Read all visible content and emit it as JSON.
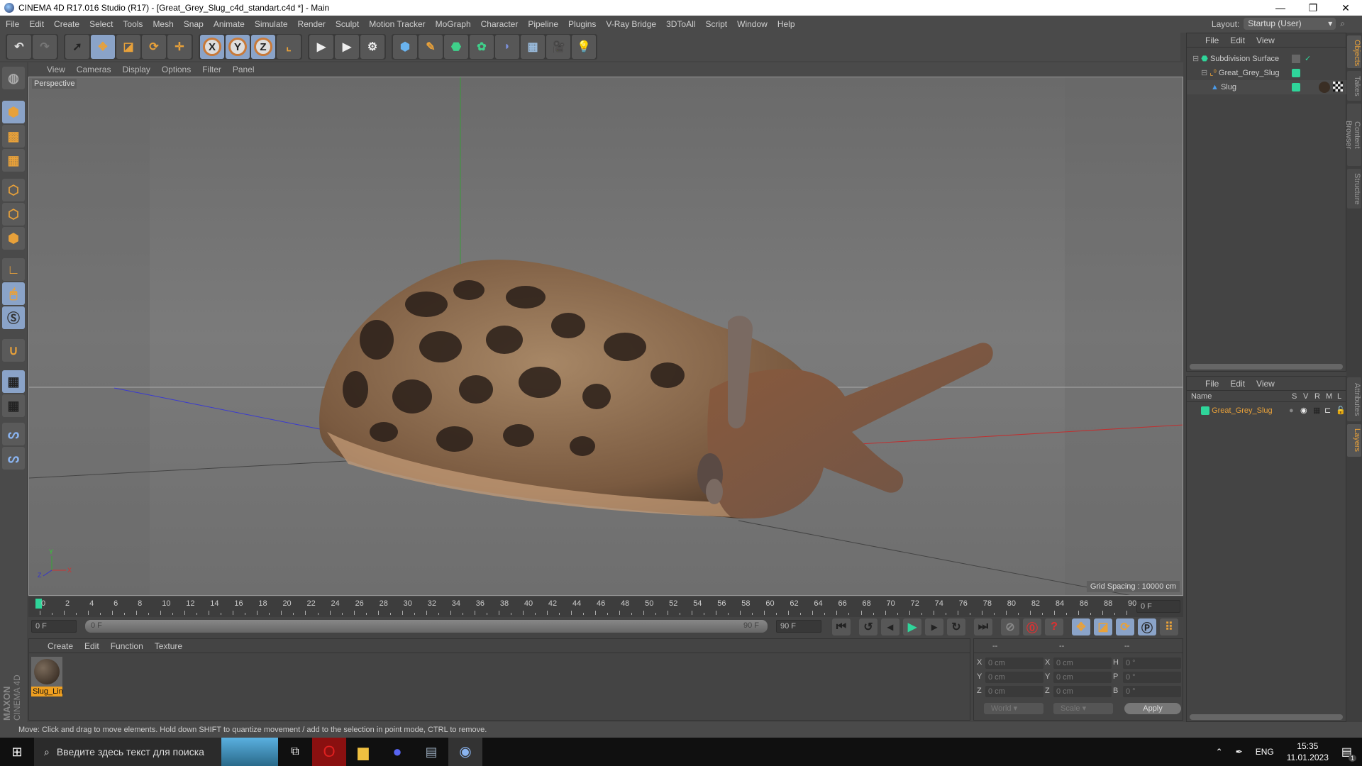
{
  "window": {
    "title": "CINEMA 4D R17.016 Studio (R17) - [Great_Grey_Slug_c4d_standart.c4d *] - Main",
    "minimize": "—",
    "maximize": "❐",
    "close": "✕"
  },
  "menu": [
    "File",
    "Edit",
    "Create",
    "Select",
    "Tools",
    "Mesh",
    "Snap",
    "Animate",
    "Simulate",
    "Render",
    "Sculpt",
    "Motion Tracker",
    "MoGraph",
    "Character",
    "Pipeline",
    "Plugins",
    "V-Ray Bridge",
    "3DToAll",
    "Script",
    "Window",
    "Help"
  ],
  "layout": {
    "label": "Layout:",
    "value": "Startup (User)"
  },
  "toolbar": {
    "axis": [
      "X",
      "Y",
      "Z"
    ]
  },
  "viewport": {
    "menu": [
      "View",
      "Cameras",
      "Display",
      "Options",
      "Filter",
      "Panel"
    ],
    "camera": "Perspective",
    "grid_spacing": "Grid Spacing : 10000 cm",
    "axis_labels": {
      "x": "X",
      "y": "Y",
      "z": "Z"
    }
  },
  "timeline": {
    "start": 0,
    "end": 90,
    "step": 2,
    "current_frame": "0 F",
    "start_field": "0 F",
    "range_start": "0 F",
    "range_end": "90 F",
    "end_field": "90 F"
  },
  "material_manager": {
    "menu": [
      "Create",
      "Edit",
      "Function",
      "Texture"
    ],
    "materials": [
      {
        "name": "Slug_Lin"
      }
    ]
  },
  "coordinates": {
    "headers": [
      "--",
      "--",
      "--"
    ],
    "rows": [
      {
        "l1": "X",
        "v1": "0 cm",
        "l2": "X",
        "v2": "0 cm",
        "l3": "H",
        "v3": "0 °"
      },
      {
        "l1": "Y",
        "v1": "0 cm",
        "l2": "Y",
        "v2": "0 cm",
        "l3": "P",
        "v3": "0 °"
      },
      {
        "l1": "Z",
        "v1": "0 cm",
        "l2": "Z",
        "v2": "0 cm",
        "l3": "B",
        "v3": "0 °"
      }
    ],
    "mode": "World",
    "transform": "Scale",
    "apply": "Apply"
  },
  "object_manager": {
    "menu": [
      "File",
      "Edit",
      "View"
    ],
    "objects": [
      {
        "name": "Subdivision Surface"
      },
      {
        "name": "Great_Grey_Slug"
      },
      {
        "name": "Slug"
      }
    ]
  },
  "layer_manager": {
    "menu": [
      "File",
      "Edit",
      "View"
    ],
    "columns": [
      "Name",
      "S",
      "V",
      "R",
      "M",
      "L"
    ],
    "layers": [
      {
        "name": "Great_Grey_Slug",
        "color": "#2fd59a"
      }
    ]
  },
  "side_tabs": {
    "top": [
      "Objects",
      "Takes",
      "Content Browser",
      "Structure"
    ],
    "bottom": [
      "Attributes",
      "Layers"
    ]
  },
  "brand": {
    "maxon": "MAXON",
    "product": "CINEMA 4D"
  },
  "status": "Move: Click and drag to move elements. Hold down SHIFT to quantize movement / add to the selection in point mode, CTRL to remove.",
  "taskbar": {
    "search_placeholder": "Введите здесь текст для поиска",
    "lang": "ENG",
    "time": "15:35",
    "date": "11.01.2023",
    "notifications": "1"
  },
  "colors": {
    "accent": "#e8a13a",
    "selected": "#8aa3c8",
    "layer_green": "#2fd59a"
  }
}
